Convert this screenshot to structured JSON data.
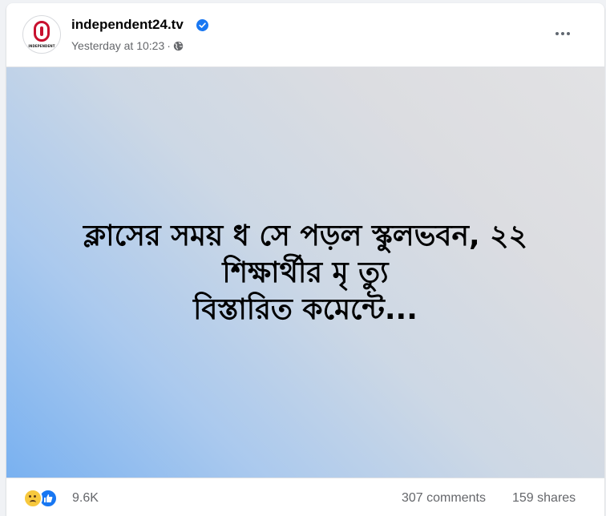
{
  "post": {
    "page_name": "independent24.tv",
    "verified": true,
    "timestamp": "Yesterday at 10:23",
    "separator": "·",
    "audience_icon": "globe-icon",
    "avatar_text": "INDEPENDENT",
    "more_icon": "more-options-icon"
  },
  "image": {
    "headline_lines": [
      "ক্লাসের সময় ধ সে পড়ল স্কুলভবন, ২২",
      "শিক্ষার্থীর মৃ ত্যু",
      "বিস্তারিত কমেন্টে..."
    ]
  },
  "footer": {
    "reactions": [
      "sad-reaction-icon",
      "like-reaction-icon"
    ],
    "reaction_count": "9.6K",
    "comments": "307 comments",
    "shares": "159 shares"
  },
  "colors": {
    "verified_blue": "#1877f2",
    "brand_red": "#c8102e",
    "secondary_text": "#65676b"
  }
}
